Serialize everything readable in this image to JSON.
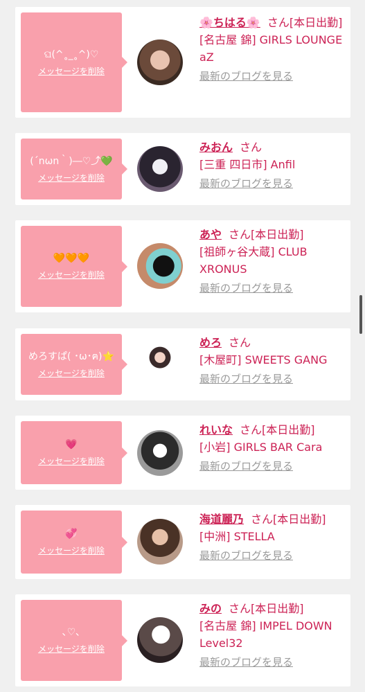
{
  "delete_label": "メッセージを削除",
  "blog_label": "最新のブログを見る",
  "honorific": "さん",
  "cards": [
    {
      "message": "ଘ(^˳_˳^)♡",
      "name": "🌸ちはる🌸",
      "status": "[本日出勤]",
      "shop": "[名古屋 錦] GIRLS LOUNGE aZ"
    },
    {
      "message": "(´nωn｀)―♡⤴💚",
      "name": "みおん",
      "status": "",
      "shop": "[三重 四日市] Anfil"
    },
    {
      "message": "🧡🧡🧡",
      "name": "あや",
      "status": "[本日出勤]",
      "shop": "[祖師ヶ谷大蔵] CLUB XRONUS"
    },
    {
      "message": "めろすぱ( ･ω･ฅ)⭐",
      "name": "めろ",
      "status": "",
      "shop": "[木屋町] SWEETS GANG"
    },
    {
      "message": "💗",
      "name": "れいな",
      "status": "[本日出勤]",
      "shop": "[小岩] GIRLS BAR Cara"
    },
    {
      "message": "💞",
      "name": "海道麗乃",
      "status": "[本日出勤]",
      "shop": "[中洲] STELLA"
    },
    {
      "message": "､♡､",
      "name": "みの",
      "status": "[本日出勤]",
      "shop": "[名古屋 錦] IMPEL DOWN Level32"
    }
  ]
}
